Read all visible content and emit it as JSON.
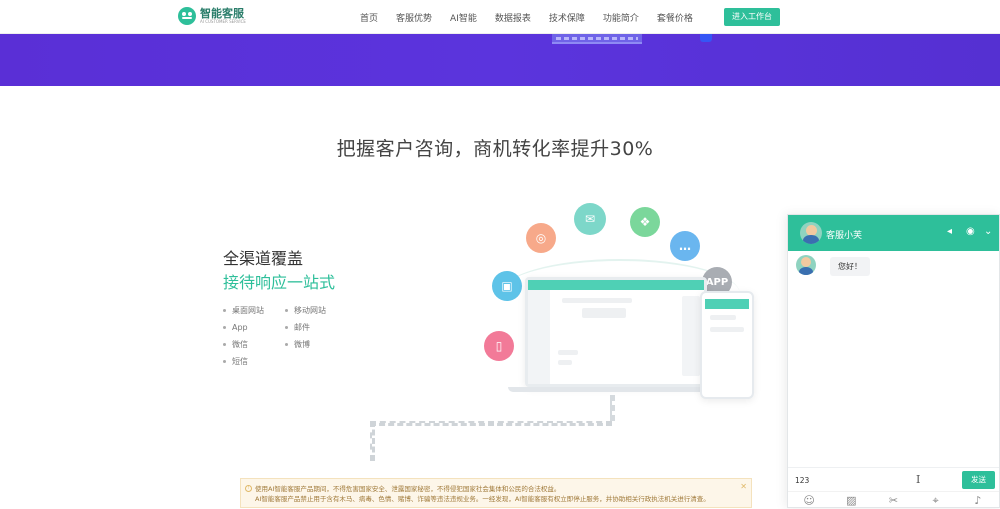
{
  "nav": {
    "logo_title": "智能客服",
    "logo_subtitle": "AI CUSTOMER SERVICE",
    "links": [
      "首页",
      "客服优势",
      "AI智能",
      "数据报表",
      "技术保障",
      "功能简介",
      "套餐价格"
    ],
    "cta": "进入工作台"
  },
  "hero": {
    "headline": "把握客户咨询，商机转化率提升30%"
  },
  "feature": {
    "title_line1": "全渠道覆盖",
    "title_line2": "接待响应一站式",
    "channels": [
      "桌面网站",
      "移动网站",
      "App",
      "邮件",
      "微信",
      "微博",
      "短信"
    ]
  },
  "illustration": {
    "app_label": "APP",
    "accent": "#2ebf9a"
  },
  "notice": {
    "line1": "使用AI智能客服产品期间，不得危害国家安全、泄露国家秘密，不得侵犯国家社会集体和公民的合法权益。",
    "line2": "AI智能客服产品禁止用于含有木马、病毒、色情、赌博、诈骗等违法违规业务。一经发现，AI智能客服有权立即停止服务，并协助相关行政执法机关进行清查。"
  },
  "chat": {
    "agent_name": "客服小芙",
    "message": "您好！",
    "input_value": "123",
    "send_label": "发送",
    "brand_color": "#2ebf9a"
  },
  "colors": {
    "banner": "#5a2fd6",
    "accent": "#2ebf9a"
  }
}
